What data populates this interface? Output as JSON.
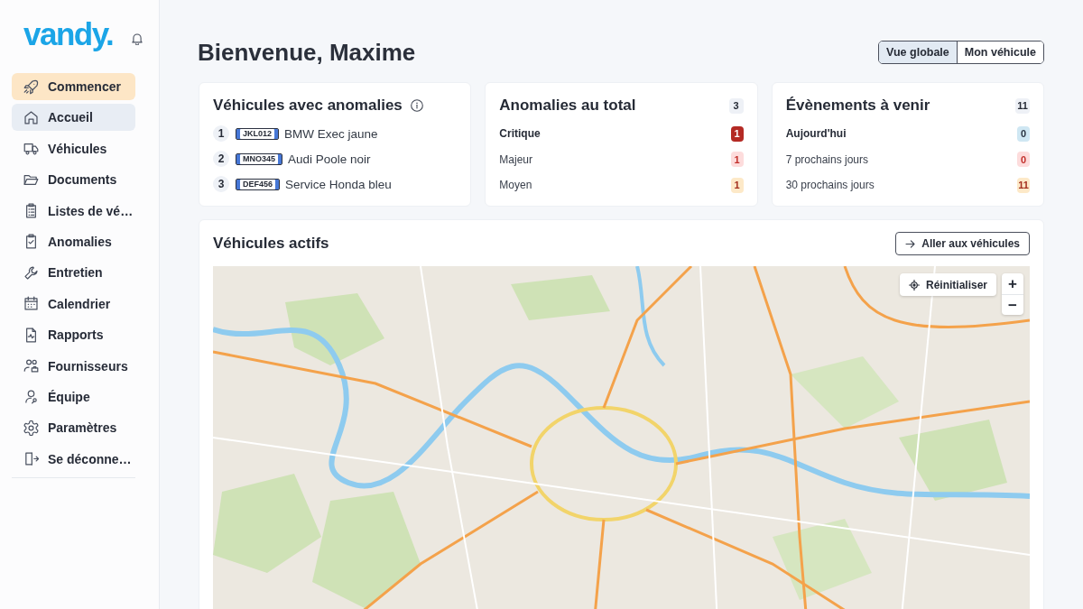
{
  "sidebar": {
    "logo": "vandy.",
    "items": [
      {
        "label": "Commencer",
        "kind": "featured",
        "selected": false
      },
      {
        "label": "Accueil",
        "kind": "link",
        "selected": true
      },
      {
        "label": "Véhicules",
        "kind": "link",
        "selected": false
      },
      {
        "label": "Documents",
        "kind": "link",
        "selected": false
      },
      {
        "label": "Listes de vé…",
        "kind": "link",
        "selected": false
      },
      {
        "label": "Anomalies",
        "kind": "link",
        "selected": false
      },
      {
        "label": "Entretien",
        "kind": "link",
        "selected": false
      },
      {
        "label": "Calendrier",
        "kind": "link",
        "selected": false
      },
      {
        "label": "Rapports",
        "kind": "link",
        "selected": false
      },
      {
        "label": "Fournisseurs",
        "kind": "link",
        "selected": false
      },
      {
        "label": "Équipe",
        "kind": "link",
        "selected": false
      },
      {
        "label": "Paramètres",
        "kind": "link",
        "selected": false
      },
      {
        "label": "Se déconne…",
        "kind": "link",
        "selected": false
      }
    ]
  },
  "header": {
    "title": "Bienvenue, Maxime",
    "view_switch": [
      {
        "label": "Vue globale",
        "selected": true
      },
      {
        "label": "Mon véhicule",
        "selected": false
      }
    ]
  },
  "anomaly_vehicles": {
    "title": "Véhicules avec anomalies",
    "rows": [
      {
        "rank": "1",
        "plate": "JKL012",
        "name": "BMW Exec jaune"
      },
      {
        "rank": "2",
        "plate": "MNO345",
        "name": "Audi Poole noir"
      },
      {
        "rank": "3",
        "plate": "DEF456",
        "name": "Service Honda bleu"
      }
    ]
  },
  "anomaly_totals": {
    "title": "Anomalies au total",
    "count": "3",
    "rows": [
      {
        "label": "Critique",
        "emphasis": true,
        "kind": "solid",
        "count": "1"
      },
      {
        "label": "Majeur",
        "emphasis": false,
        "kind": "danger",
        "count": "1"
      },
      {
        "label": "Moyen",
        "emphasis": false,
        "kind": "warning",
        "count": "1"
      }
    ]
  },
  "upcoming_events": {
    "title": "Évènements à venir",
    "count": "11",
    "rows": [
      {
        "label": "Aujourd'hui",
        "emphasis": true,
        "kind": "info",
        "count": "0"
      },
      {
        "label": "7 prochains jours",
        "emphasis": false,
        "kind": "danger",
        "count": "0"
      },
      {
        "label": "30 prochains jours",
        "emphasis": false,
        "kind": "warning",
        "count": "11"
      }
    ]
  },
  "active_vehicles": {
    "title": "Véhicules actifs",
    "button": "Aller aux véhicules",
    "map": {
      "reset_button": "Réinitialiser",
      "zoom_in": "+",
      "zoom_out": "−"
    }
  }
}
